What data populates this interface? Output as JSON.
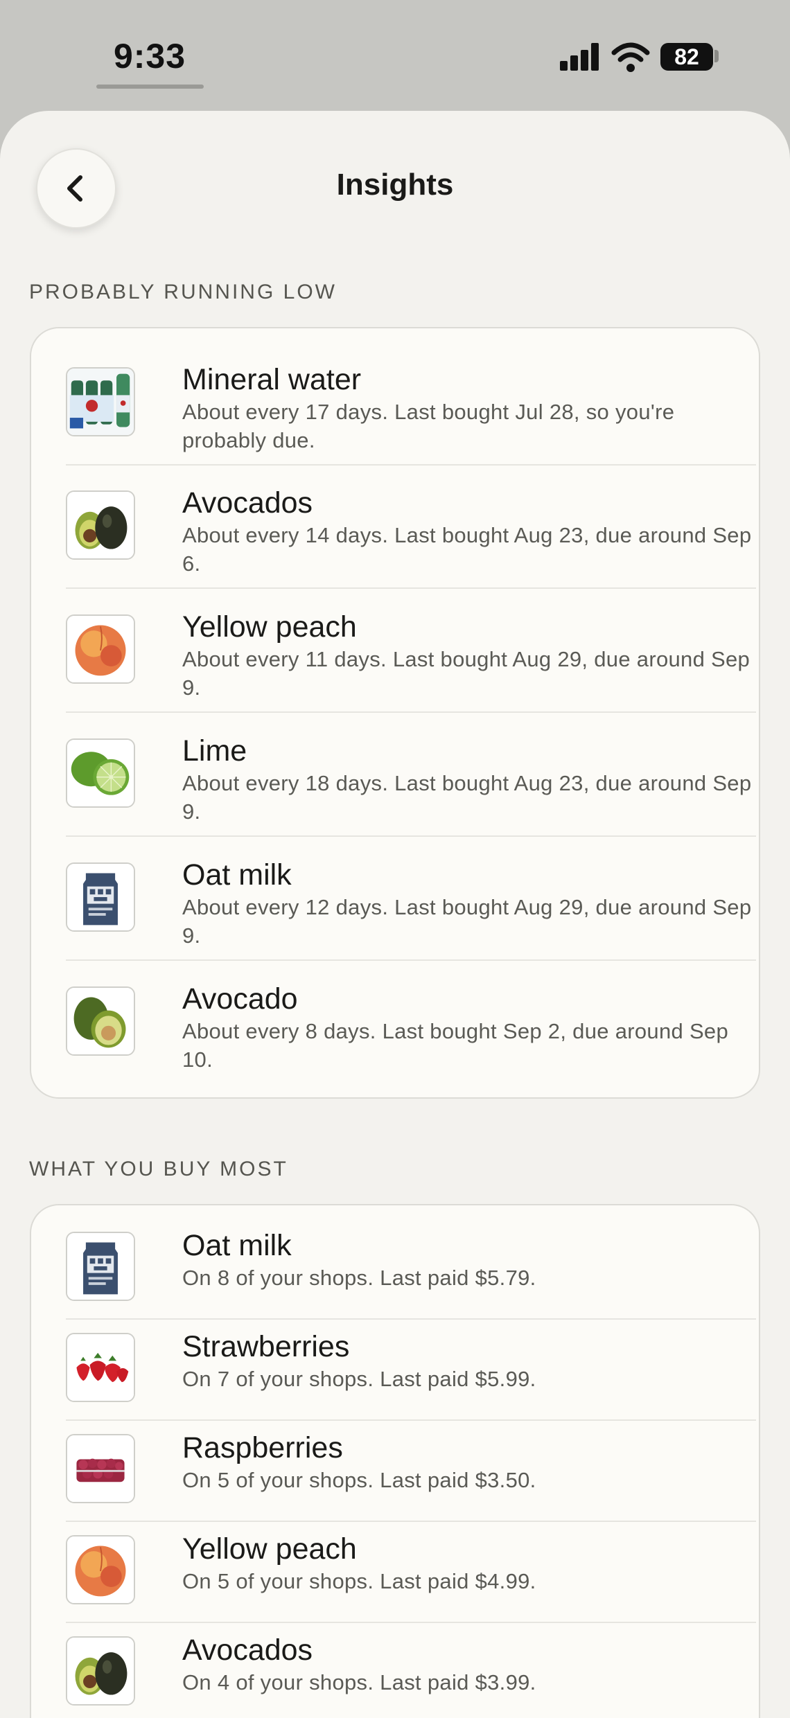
{
  "status_bar": {
    "time": "9:33",
    "battery": "82"
  },
  "header": {
    "title": "Insights"
  },
  "running_low": {
    "title": "PROBABLY RUNNING LOW",
    "items": [
      {
        "name": "Mineral water",
        "detail": "About every 17 days. Last bought Jul 28, so you're probably due.",
        "icon": "mineral-water-image"
      },
      {
        "name": "Avocados",
        "detail": "About every 14 days. Last bought Aug 23, due around Sep 6.",
        "icon": "avocados-image"
      },
      {
        "name": "Yellow peach",
        "detail": "About every 11 days. Last bought Aug 29, due around Sep 9.",
        "icon": "peach-image"
      },
      {
        "name": "Lime",
        "detail": "About every 18 days. Last bought Aug 23, due around Sep 9.",
        "icon": "lime-image"
      },
      {
        "name": "Oat milk",
        "detail": "About every 12 days. Last bought Aug 29, due around Sep 9.",
        "icon": "oat-milk-image"
      },
      {
        "name": "Avocado",
        "detail": "About every 8 days. Last bought Sep 2, due around Sep 10.",
        "icon": "avocado-image"
      }
    ]
  },
  "buy_most": {
    "title": "WHAT YOU BUY MOST",
    "items": [
      {
        "name": "Oat milk",
        "detail": "On 8 of your shops. Last paid $5.79.",
        "icon": "oat-milk-image"
      },
      {
        "name": "Strawberries",
        "detail": "On 7 of your shops. Last paid $5.99.",
        "icon": "strawberries-image"
      },
      {
        "name": "Raspberries",
        "detail": "On 5 of your shops. Last paid $3.50.",
        "icon": "raspberries-image"
      },
      {
        "name": "Yellow peach",
        "detail": "On 5 of your shops. Last paid $4.99.",
        "icon": "peach-image"
      },
      {
        "name": "Avocados",
        "detail": "On 4 of your shops. Last paid $3.99.",
        "icon": "avocados-image"
      }
    ]
  },
  "colors": {
    "background": "#f3f2ee",
    "card": "#fcfbf7",
    "text": "#1a1a18",
    "secondary_text": "#5a5a55"
  }
}
